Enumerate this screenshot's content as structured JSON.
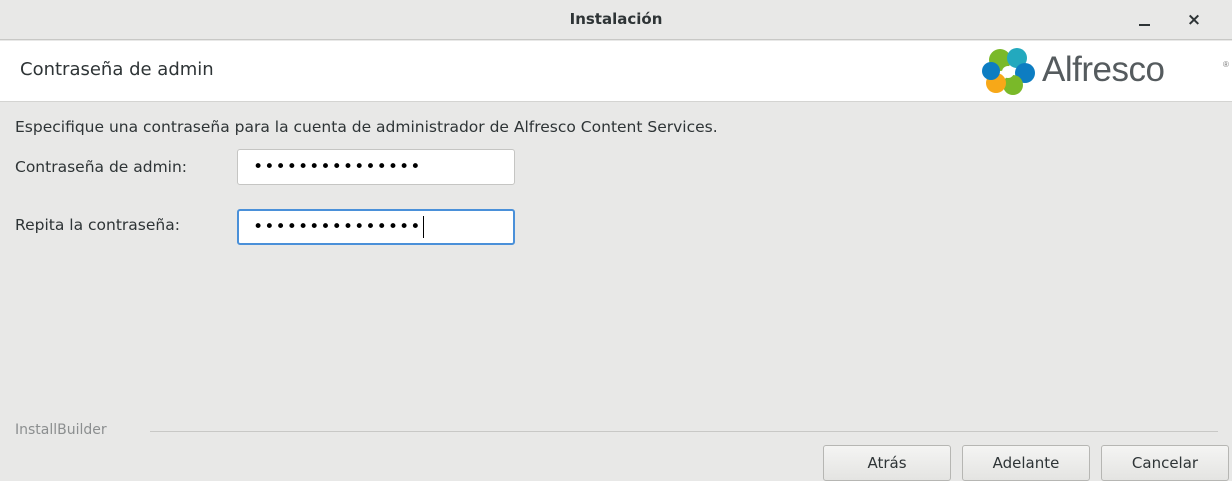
{
  "window": {
    "title": "Instalación",
    "minimize_icon": "minimize-icon",
    "close_glyph": "×"
  },
  "header": {
    "heading": "Contraseña de admin",
    "logo_text": "Alfresco",
    "logo_tm": "®"
  },
  "form": {
    "description": "Especifique una contraseña para la cuenta de administrador de Alfresco Content Services.",
    "password_label": "Contraseña de admin:",
    "password_value": "•••••••••••••••",
    "repeat_label": "Repita la contraseña:",
    "repeat_value": "•••••••••••••••"
  },
  "footer": {
    "brand": "InstallBuilder",
    "back_label": "Atrás",
    "next_label": "Adelante",
    "cancel_label": "Cancelar"
  },
  "colors": {
    "focus_border": "#4a90d9",
    "logo_green": "#7ab929",
    "logo_blue": "#0d7dc2",
    "logo_orange": "#f7a818",
    "logo_teal": "#23a9be"
  }
}
